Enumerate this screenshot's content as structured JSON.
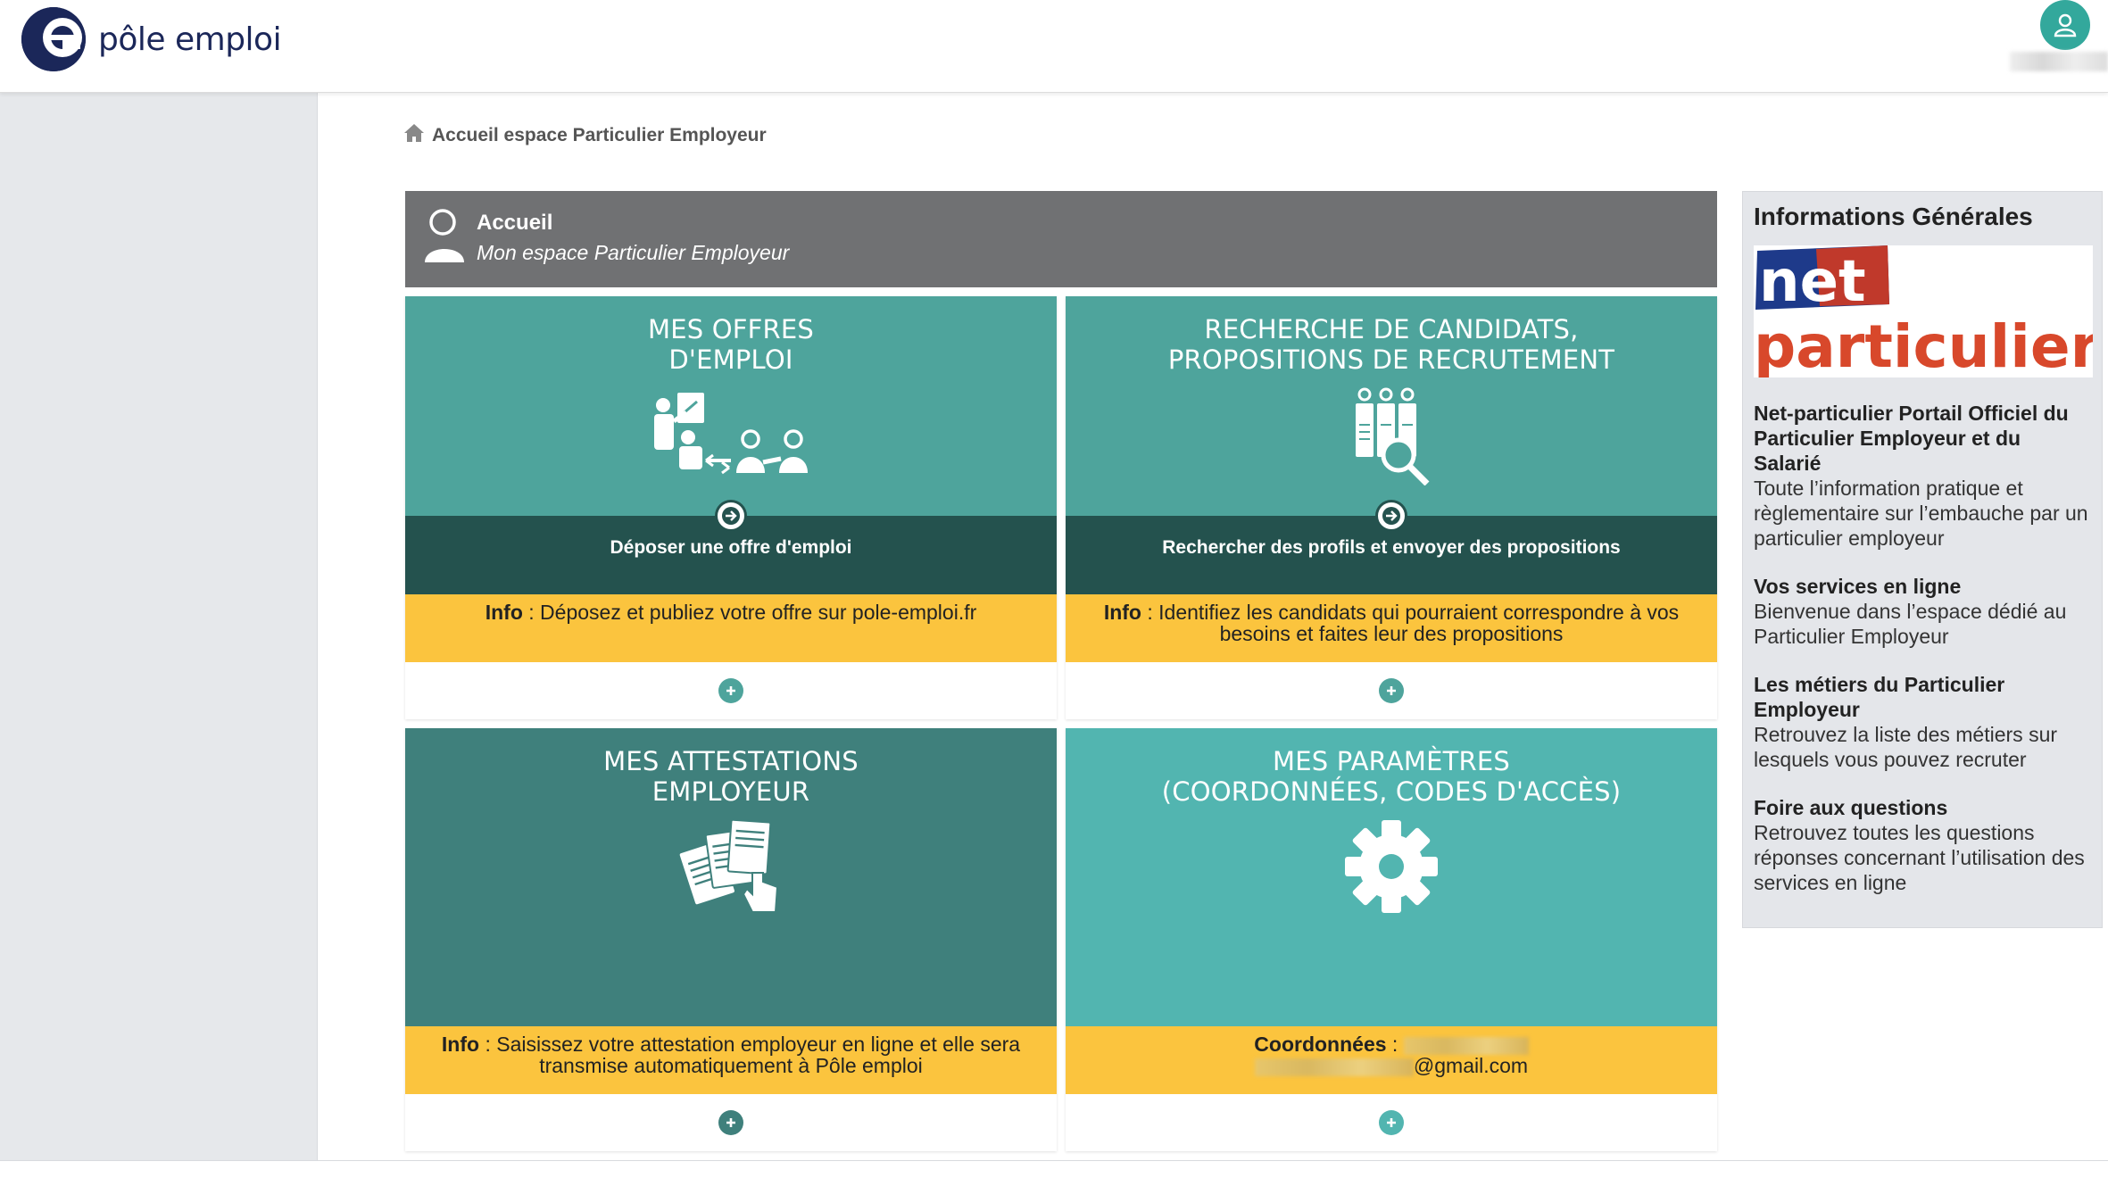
{
  "brand": {
    "name": "pôle emploi"
  },
  "breadcrumb": {
    "label": "Accueil espace Particulier Employeur"
  },
  "header": {
    "title": "Accueil",
    "subtitle": "Mon espace Particulier Employeur"
  },
  "cards": [
    {
      "title_line1": "MES OFFRES",
      "title_line2": "D'EMPLOI",
      "action": "Déposer une offre d'emploi",
      "info_label": "Info",
      "info_text": " : Déposez et publiez votre offre sur pole-emploi.fr"
    },
    {
      "title_line1": "RECHERCHE DE CANDIDATS,",
      "title_line2": "PROPOSITIONS DE RECRUTEMENT",
      "action": "Rechercher des profils et envoyer des propositions",
      "info_label": "Info",
      "info_text": " : Identifiez les candidats qui pourraient correspondre à vos besoins et faites leur des propositions"
    },
    {
      "title_line1": "MES ATTESTATIONS",
      "title_line2": "EMPLOYEUR",
      "info_label": "Info",
      "info_text": " : Saisissez votre attestation employeur en ligne et elle sera transmise automatiquement à Pôle emploi"
    },
    {
      "title_line1": "MES PARAMÈTRES",
      "title_line2": "(COORDONNÉES, CODES D'ACCÈS)",
      "info_label": "Coordonnées",
      "info_sep": " : ",
      "email_suffix": "@gmail.com"
    }
  ],
  "sidebar": {
    "title": "Informations Générales",
    "banner": {
      "part1": "net",
      "part2": "particulier.fr"
    },
    "items": [
      {
        "heading": "Net-particulier Portail Officiel du Particulier Employeur et du Salarié",
        "text": "Toute l’information pratique et règlementaire sur l’embauche par un particulier employeur"
      },
      {
        "heading": "Vos services en ligne",
        "text": "Bienvenue dans l’espace dédié au Particulier Employeur"
      },
      {
        "heading": "Les métiers du Particulier Employeur",
        "text": "Retrouvez la liste des métiers sur lesquels vous pouvez recruter"
      },
      {
        "heading": "Foire aux questions",
        "text": "Retrouvez toutes les questions réponses concernant l’utilisation des services en ligne"
      }
    ]
  },
  "colors": {
    "teal_card_1": "#4ea49c",
    "teal_card_3": "#3f807c",
    "teal_card_4": "#52b5b0",
    "action_bar": "#24524e",
    "info_yellow": "#fbc43e",
    "header_grey": "#707173",
    "brand_navy": "#1b2759"
  },
  "icons": [
    "home-icon",
    "user-icon",
    "person-icon",
    "arrow-right-icon",
    "plus-icon",
    "job-offer-icon",
    "candidate-search-icon",
    "attestation-icon",
    "gear-icon"
  ]
}
